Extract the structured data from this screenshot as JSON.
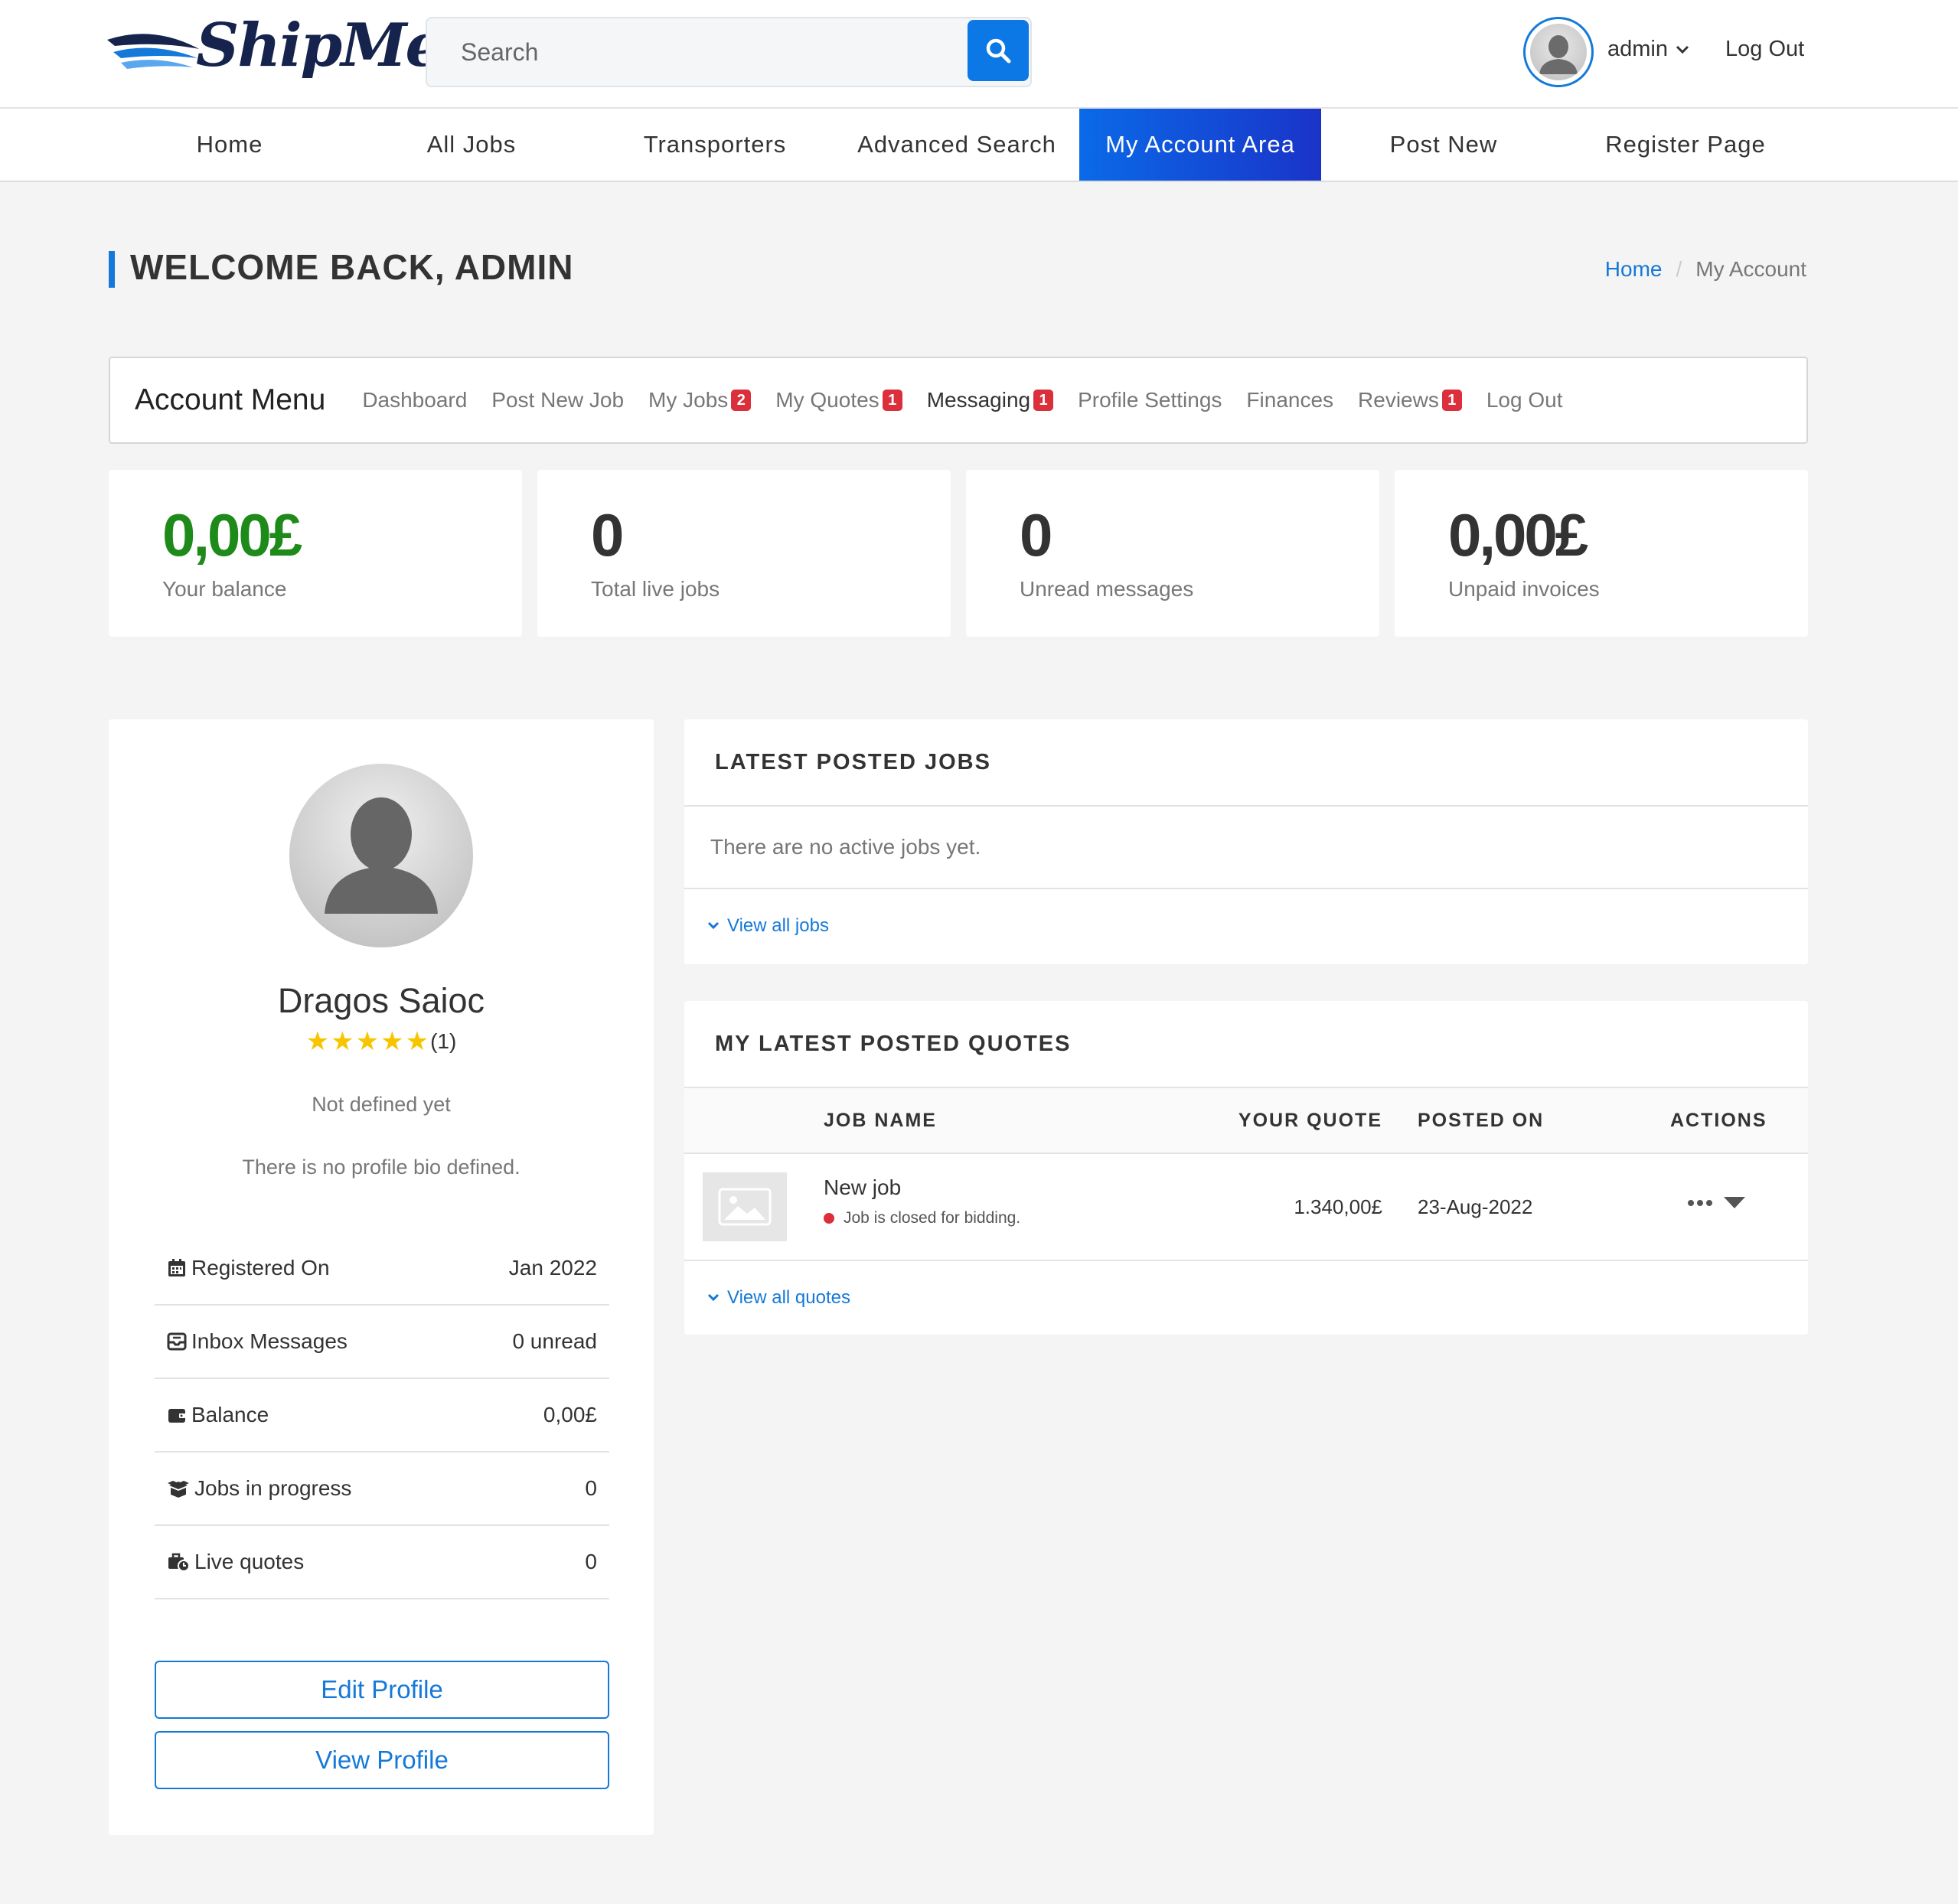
{
  "brand": {
    "logo_text": "ShipMe",
    "accent": "#1479d8"
  },
  "search": {
    "placeholder": "Search"
  },
  "user": {
    "name": "admin",
    "logout": "Log Out"
  },
  "nav": [
    {
      "label": "Home"
    },
    {
      "label": "All Jobs"
    },
    {
      "label": "Transporters"
    },
    {
      "label": "Advanced Search"
    },
    {
      "label": "My Account Area",
      "active": true
    },
    {
      "label": "Post New"
    },
    {
      "label": "Register Page"
    }
  ],
  "page": {
    "title": "WELCOME BACK, ADMIN",
    "breadcrumb": {
      "home": "Home",
      "separator": "/",
      "current": "My Account"
    }
  },
  "account_menu": {
    "title": "Account Menu",
    "items": [
      {
        "label": "Dashboard"
      },
      {
        "label": "Post New Job"
      },
      {
        "label": "My Jobs",
        "badge": "2"
      },
      {
        "label": "My Quotes",
        "badge": "1"
      },
      {
        "label": "Messaging",
        "badge": "1"
      },
      {
        "label": "Profile Settings"
      },
      {
        "label": "Finances"
      },
      {
        "label": "Reviews",
        "badge": "1"
      },
      {
        "label": "Log Out"
      }
    ]
  },
  "stats": [
    {
      "value": "0,00£",
      "label": "Your balance",
      "color": "#1e8a1a"
    },
    {
      "value": "0",
      "label": "Total live jobs"
    },
    {
      "value": "0",
      "label": "Unread messages"
    },
    {
      "value": "0,00£",
      "label": "Unpaid invoices"
    }
  ],
  "profile": {
    "name": "Dragos Saioc",
    "rating_stars": 5,
    "rating_count": "(1)",
    "tagline": "Not defined yet",
    "bio": "There is no profile bio defined.",
    "rows": [
      {
        "icon": "calendar-icon",
        "label": "Registered On",
        "value": "Jan 2022"
      },
      {
        "icon": "inbox-icon",
        "label": "Inbox Messages",
        "value": "0 unread"
      },
      {
        "icon": "wallet-icon",
        "label": "Balance",
        "value": "0,00£"
      },
      {
        "icon": "box-open-icon",
        "label": "Jobs in progress",
        "value": "0"
      },
      {
        "icon": "briefcase-clock-icon",
        "label": "Live quotes",
        "value": "0"
      }
    ],
    "edit_button": "Edit Profile",
    "view_button": "View Profile"
  },
  "latest_jobs": {
    "title": "LATEST POSTED JOBS",
    "empty_text": "There are no active jobs yet.",
    "view_all": "View all jobs"
  },
  "latest_quotes": {
    "title": "MY LATEST POSTED QUOTES",
    "columns": {
      "job_name": "JOB NAME",
      "your_quote": "YOUR QUOTE",
      "posted_on": "POSTED ON",
      "actions": "ACTIONS"
    },
    "rows": [
      {
        "job_name": "New job",
        "status": "Job is closed for bidding.",
        "status_color": "#dc2f3c",
        "quote": "1.340,00£",
        "posted_on": "23-Aug-2022"
      }
    ],
    "view_all": "View all quotes"
  }
}
